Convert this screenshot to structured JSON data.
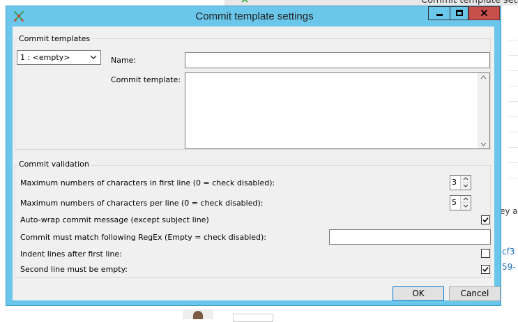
{
  "background": {
    "window_title": "Commit template set",
    "texts": [
      "ey a",
      "cf3",
      "59-"
    ]
  },
  "dialog": {
    "title": "Commit template settings",
    "accent_color": "#6ac6ea",
    "close_color": "#c7504c"
  },
  "templates_group": {
    "label": "Commit templates",
    "select_value": "1 : <empty>",
    "name_label": "Name:",
    "name_value": "",
    "template_label": "Commit template:",
    "template_value": ""
  },
  "validation_group": {
    "label": "Commit validation",
    "max_first_line_label": "Maximum numbers of characters in first line (0 = check disabled):",
    "max_first_line_value": "3",
    "max_per_line_label": "Maximum numbers of characters per line (0 = check disabled):",
    "max_per_line_value": "5",
    "autowrap_label": "Auto-wrap commit message (except subject line)",
    "autowrap_checked": true,
    "regex_label": "Commit must match following RegEx (Empty = check disabled):",
    "regex_value": "",
    "indent_label": "Indent lines after first line:",
    "indent_checked": false,
    "second_line_label": "Second line must be empty:",
    "second_line_checked": true
  },
  "buttons": {
    "ok": "OK",
    "cancel": "Cancel"
  },
  "icons": [
    "app-icon",
    "minimize-icon",
    "maximize-icon",
    "close-icon",
    "chevron-down-icon",
    "scroll-up-icon",
    "scroll-down-icon",
    "checkmark-icon"
  ]
}
